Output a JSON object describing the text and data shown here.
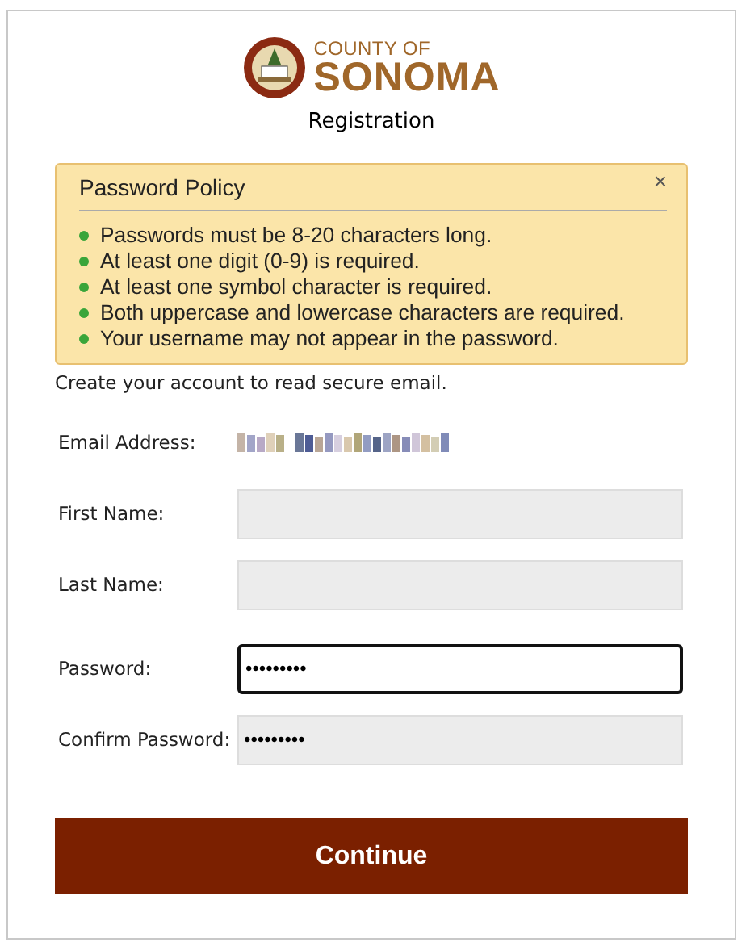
{
  "header": {
    "logo_small": "COUNTY OF",
    "logo_large": "SONOMA",
    "title": "Registration"
  },
  "policy": {
    "title": "Password Policy",
    "close": "×",
    "rules": [
      {
        "text": "Passwords must be 8-20 characters long."
      },
      {
        "text": "At least one digit (0-9) is required."
      },
      {
        "text": "At least one symbol character is required."
      },
      {
        "text": "Both uppercase and lowercase characters are required."
      },
      {
        "text": "Your username may not appear in the password."
      }
    ]
  },
  "intro": "Create your account to read secure email.",
  "fields": [
    {
      "label": "Email Address:",
      "kind": "redacted"
    },
    {
      "label": "First Name:",
      "kind": "input",
      "focused": false
    },
    {
      "label": "Last Name:",
      "kind": "input",
      "focused": false
    },
    {
      "label": "Password:",
      "kind": "input",
      "value": "•••••••••",
      "focused": true
    },
    {
      "label": "Confirm Password:",
      "kind": "input",
      "value": "•••••••••",
      "focused": false
    }
  ],
  "button": "Continue"
}
